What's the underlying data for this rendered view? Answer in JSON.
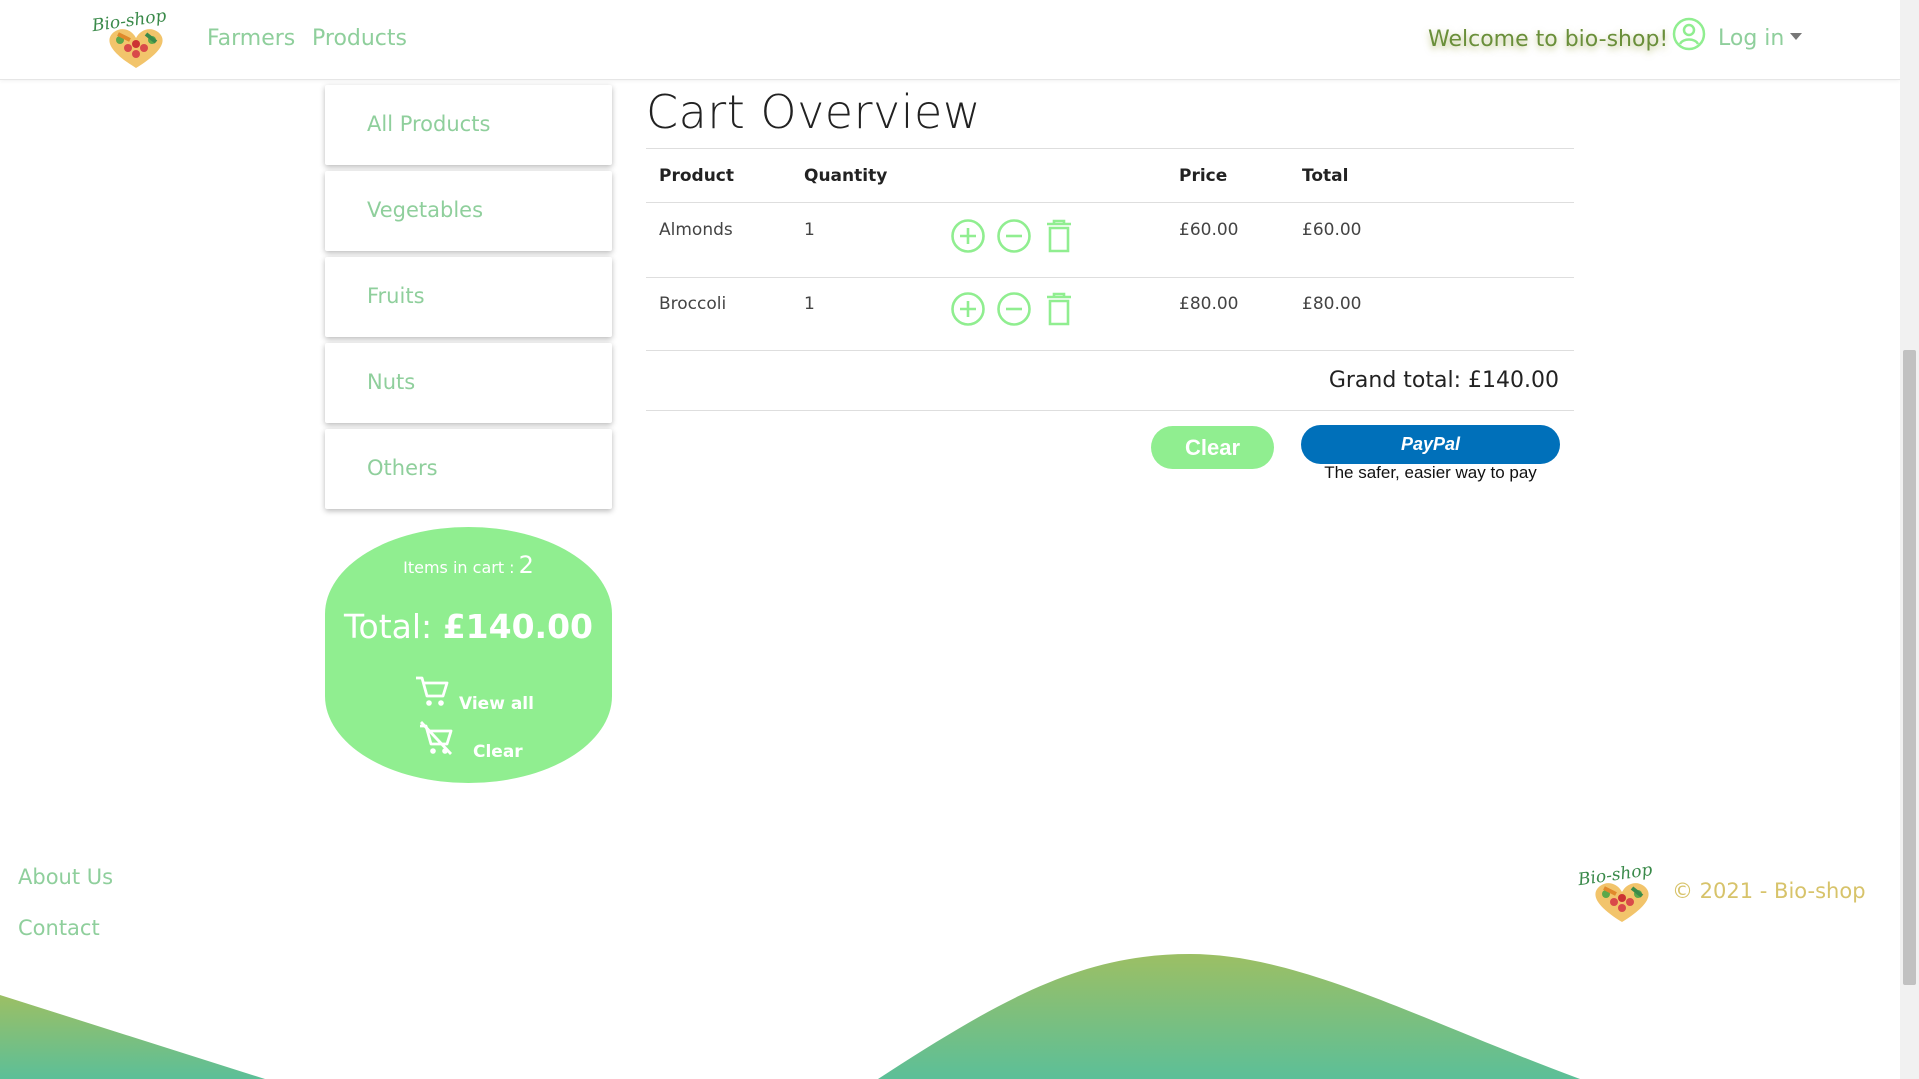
{
  "colors": {
    "accent_green": "#90ee90",
    "link_green": "#8fcf9c",
    "gold": "#d7c36a",
    "paypal_blue": "#0070ba"
  },
  "nav": {
    "brand_text": "Bio-shop",
    "farmers": "Farmers",
    "products": "Products",
    "welcome": "Welcome to bio-shop!",
    "login": "Log in"
  },
  "sidebar": {
    "categories": [
      {
        "label": "All Products"
      },
      {
        "label": "Vegetables"
      },
      {
        "label": "Fruits"
      },
      {
        "label": "Nuts"
      },
      {
        "label": "Others"
      }
    ],
    "summary": {
      "items_label": "Items in cart :",
      "items_count": "2",
      "total_label": "Total:",
      "total_value": "£140.00",
      "view_all": "View all",
      "clear": "Clear"
    }
  },
  "cart": {
    "title": "Cart Overview",
    "headers": {
      "product": "Product",
      "quantity": "Quantity",
      "price": "Price",
      "total": "Total"
    },
    "rows": [
      {
        "product": "Almonds",
        "quantity": "1",
        "price": "£60.00",
        "total": "£60.00"
      },
      {
        "product": "Broccoli",
        "quantity": "1",
        "price": "£80.00",
        "total": "£80.00"
      }
    ],
    "grand_total": "Grand total: £140.00",
    "clear_button": "Clear",
    "paypal_button": "PayPal",
    "paypal_tagline": "The safer, easier way to pay"
  },
  "footer": {
    "about": "About Us",
    "contact": "Contact",
    "copyright": "© 2021 - Bio-shop"
  },
  "icons": [
    "logo-icon",
    "user-circle-icon",
    "caret-down-icon",
    "plus-circle-icon",
    "minus-circle-icon",
    "trash-icon",
    "cart-icon",
    "cart-remove-icon"
  ]
}
